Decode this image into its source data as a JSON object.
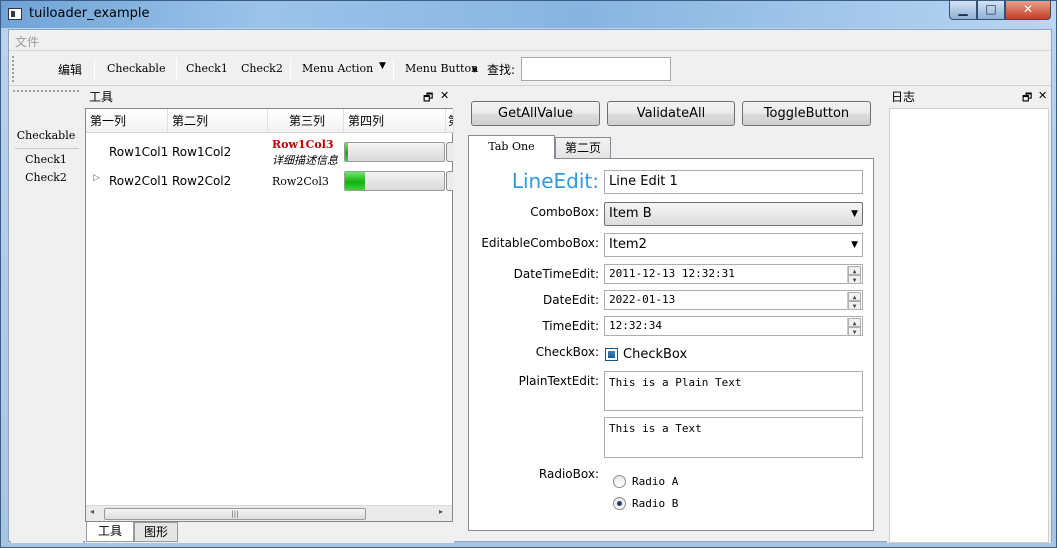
{
  "window": {
    "title": "tuiloader_example"
  },
  "menubar": {
    "items": [
      "文件"
    ]
  },
  "toolbar": {
    "edit": "编辑",
    "checkable": "Checkable",
    "check1": "Check1",
    "check2": "Check2",
    "menu_action": "Menu Action",
    "menu_button": "Menu Button",
    "search_label": "查找:",
    "search_value": ""
  },
  "left_toolbar": {
    "checkable": "Checkable",
    "check1": "Check1",
    "check2": "Check2"
  },
  "tools_dock": {
    "title": "工具",
    "headers": [
      "第一列",
      "第二列",
      "第三列",
      "第四列",
      "第"
    ],
    "rows": [
      {
        "c1": "Row1Col1",
        "c2": "Row1Col2",
        "c3_title": "Row1Col3",
        "c3_desc": "详细描述信息",
        "progress": 0.03
      },
      {
        "c1": "Row2Col1",
        "c2": "Row2Col2",
        "c3_title": "Row2Col3",
        "progress": 0.2
      }
    ],
    "bottom_tabs": [
      "工具",
      "图形"
    ]
  },
  "center": {
    "buttons": [
      "GetAllValue",
      "ValidateAll",
      "ToggleButton"
    ],
    "tabs": [
      "Tab One",
      "第二页"
    ],
    "form": {
      "lineedit_label": "LineEdit:",
      "lineedit_value": "Line Edit 1",
      "combobox_label": "ComboBox:",
      "combobox_value": "Item B",
      "editable_combo_label": "EditableComboBox:",
      "editable_combo_value": "Item2",
      "datetime_label": "DateTimeEdit:",
      "datetime_value": "2011-12-13 12:32:31",
      "date_label": "DateEdit:",
      "date_value": "2022-01-13",
      "time_label": "TimeEdit:",
      "time_value": "12:32:34",
      "checkbox_label": "CheckBox:",
      "checkbox_text": "CheckBox",
      "plaintext_label": "PlainTextEdit:",
      "plaintext_value": "This is a Plain Text",
      "text_value": "This is a Text",
      "radio_label": "RadioBox:",
      "radio_a": "Radio A",
      "radio_b": "Radio B"
    }
  },
  "log_dock": {
    "title": "日志"
  }
}
